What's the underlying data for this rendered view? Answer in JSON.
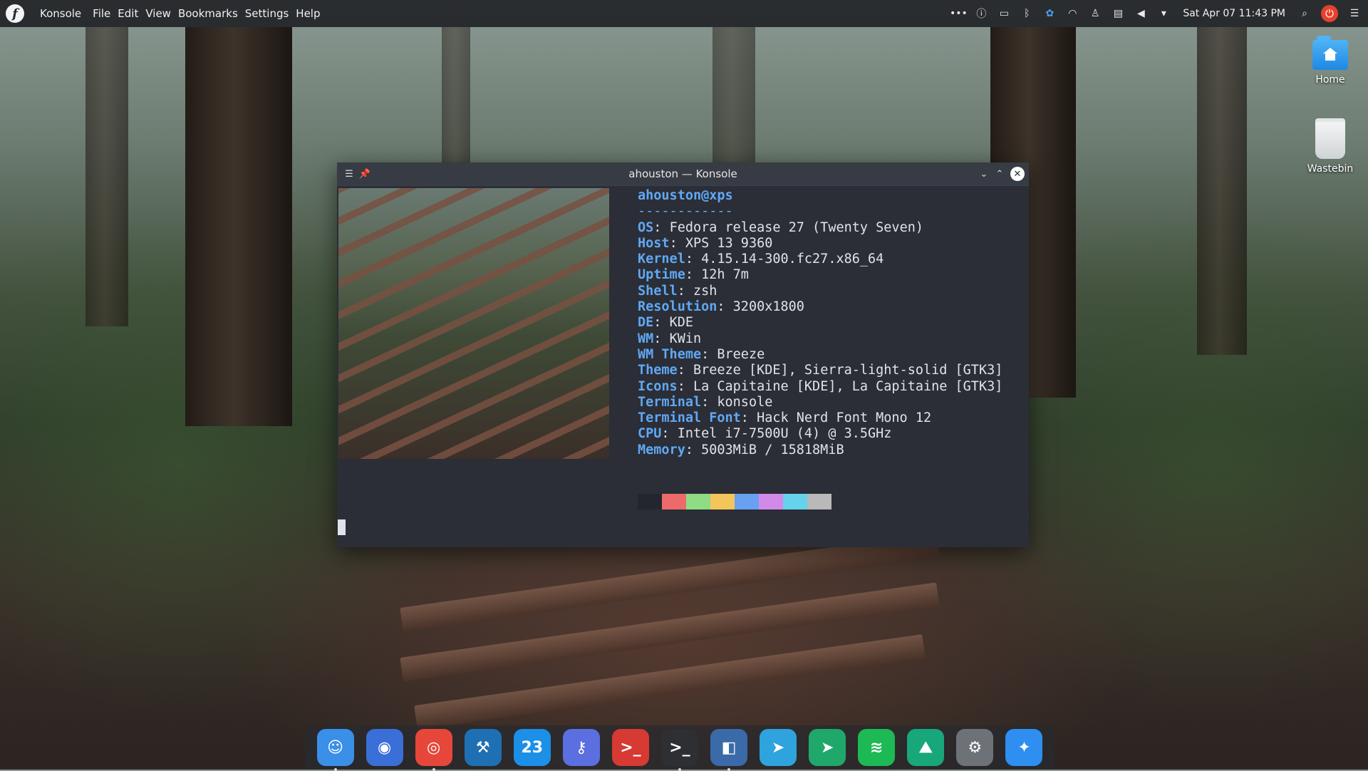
{
  "panel": {
    "app_name": "Konsole",
    "menu": [
      "File",
      "Edit",
      "View",
      "Bookmarks",
      "Settings",
      "Help"
    ],
    "clock": "Sat Apr 07  11:43 PM",
    "tray": [
      "more-icon",
      "info-icon",
      "battery-icon",
      "bluetooth-icon",
      "vpn-icon",
      "wifi-icon",
      "user-icon",
      "clipboard-icon",
      "volume-icon",
      "dropdown-icon"
    ]
  },
  "desktop": {
    "home_label": "Home",
    "wastebin_label": "Wastebin"
  },
  "window": {
    "title": "ahouston — Konsole"
  },
  "neofetch": {
    "user_host": "ahouston@xps",
    "separator": "------------",
    "rows": [
      {
        "key": "OS",
        "value": "Fedora release 27 (Twenty Seven)"
      },
      {
        "key": "Host",
        "value": "XPS 13 9360"
      },
      {
        "key": "Kernel",
        "value": "4.15.14-300.fc27.x86_64"
      },
      {
        "key": "Uptime",
        "value": "12h 7m"
      },
      {
        "key": "Shell",
        "value": "zsh"
      },
      {
        "key": "Resolution",
        "value": "3200x1800"
      },
      {
        "key": "DE",
        "value": "KDE"
      },
      {
        "key": "WM",
        "value": "KWin"
      },
      {
        "key": "WM Theme",
        "value": "Breeze"
      },
      {
        "key": "Theme",
        "value": "Breeze [KDE], Sierra-light-solid [GTK3]"
      },
      {
        "key": "Icons",
        "value": "La Capitaine [KDE], La Capitaine [GTK3]"
      },
      {
        "key": "Terminal",
        "value": "konsole"
      },
      {
        "key": "Terminal Font",
        "value": "Hack Nerd Font Mono 12"
      },
      {
        "key": "CPU",
        "value": "Intel i7-7500U (4) @ 3.5GHz"
      },
      {
        "key": "Memory",
        "value": "5003MiB / 15818MiB"
      }
    ],
    "palette": [
      "#23262e",
      "#ec6a6a",
      "#8fdc84",
      "#f4c55a",
      "#6aa0f2",
      "#d28ae8",
      "#66d3ec",
      "#b9b9b9"
    ]
  },
  "dock": {
    "items": [
      {
        "name": "finder-icon",
        "glyph": "☺",
        "color": "#3a8fe8",
        "running": true
      },
      {
        "name": "firefox-icon",
        "glyph": "◉",
        "color": "#3b6fd8",
        "running": false
      },
      {
        "name": "chrome-icon",
        "glyph": "◎",
        "color": "#e6473a",
        "running": true
      },
      {
        "name": "xcode-icon",
        "glyph": "⚒",
        "color": "#1f6fb4",
        "running": false
      },
      {
        "name": "calendar-icon",
        "glyph": "23",
        "color": "#1c8fe6",
        "running": false
      },
      {
        "name": "keys-icon",
        "glyph": "⚷",
        "color": "#5b6fe0",
        "running": false
      },
      {
        "name": "terminal-red-icon",
        "glyph": ">_",
        "color": "#d63a32",
        "running": false
      },
      {
        "name": "terminal-icon",
        "glyph": ">_",
        "color": "#2d2f33",
        "running": true
      },
      {
        "name": "vscode-icon",
        "glyph": "◧",
        "color": "#3a6aa8",
        "running": true
      },
      {
        "name": "telegram-icon",
        "glyph": "➤",
        "color": "#2ea3dd",
        "running": false
      },
      {
        "name": "send-icon",
        "glyph": "➤",
        "color": "#1fa86a",
        "running": false
      },
      {
        "name": "spotify-icon",
        "glyph": "≋",
        "color": "#1db954",
        "running": false
      },
      {
        "name": "system-monitor-icon",
        "glyph": "⛰",
        "color": "#17a77a",
        "running": false
      },
      {
        "name": "settings-icon",
        "glyph": "⚙",
        "color": "#6d7278",
        "running": false
      },
      {
        "name": "kde-connect-icon",
        "glyph": "✦",
        "color": "#2e8ff0",
        "running": false
      }
    ]
  }
}
